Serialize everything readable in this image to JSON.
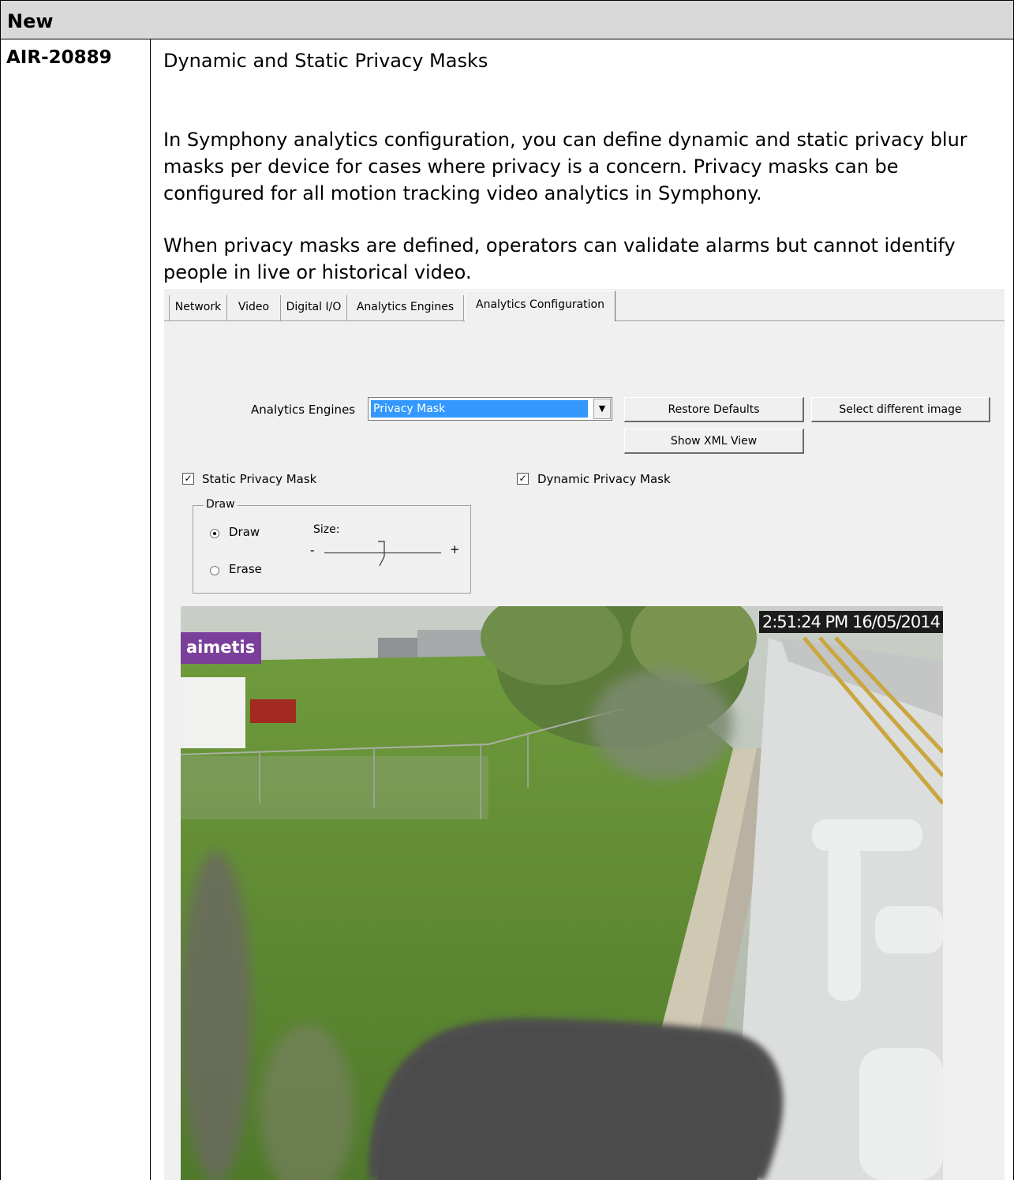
{
  "table": {
    "header": "New",
    "row_id": "AIR-20889",
    "paragraphs": [
      "Dynamic and Static Privacy Masks",
      "In Symphony analytics configuration, you can define dynamic and static privacy blur masks per device for cases where privacy is a concern. Privacy masks can be configured for all motion tracking video analytics in Symphony.",
      "When privacy masks are defined, operators can validate alarms but cannot identify people in live or historical video."
    ]
  },
  "screenshot": {
    "tabs": [
      "Network",
      "Video",
      "Digital I/O",
      "Analytics Engines",
      "Analytics Configuration"
    ],
    "active_tab": "Analytics Configuration",
    "analytics_engines_label": "Analytics Engines",
    "analytics_engines_value": "Privacy Mask",
    "restore_defaults": "Restore Defaults",
    "select_different_image": "Select different image",
    "show_xml_view": "Show XML View",
    "static_privacy_mask": "Static Privacy Mask",
    "dynamic_privacy_mask": "Dynamic Privacy Mask",
    "static_checked": true,
    "dynamic_checked": true,
    "draw_group_title": "Draw",
    "draw_option": "Draw",
    "erase_option": "Erase",
    "selected_mode": "Draw",
    "size_label": "Size:",
    "size_min": "-",
    "size_max": "+",
    "camera_logo": "aimetis",
    "camera_timestamp": "2:51:24 PM 16/05/2014"
  }
}
